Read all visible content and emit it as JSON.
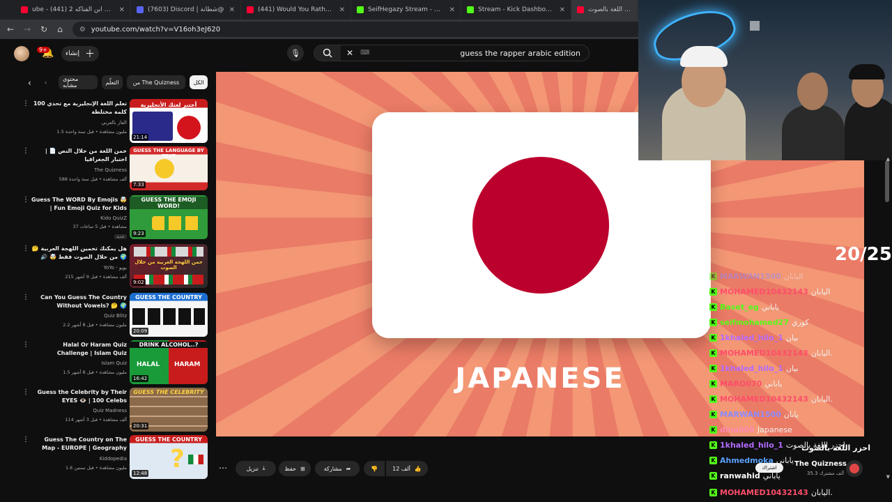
{
  "browser": {
    "tabs": [
      {
        "title": "(441) انا قلبي ابن الفناكه 2 - YouTube",
        "label": "ube - انا قلبي ابن الفناكه 2 (441)",
        "icon": "youtube-icon",
        "color": "#ff0033"
      },
      {
        "title": "(7603) Discord | شطانة@",
        "label": "(7603) Discord | شطانة@",
        "icon": "discord-icon",
        "color": "#5865f2"
      },
      {
        "title": "(441) Would You Rather...? 140",
        "label": "(441) Would You Rather...? 140",
        "icon": "youtube-icon",
        "color": "#ff0033"
      },
      {
        "title": "SeifHegazy Stream - Watch Live",
        "label": "SeifHegazy Stream - Watch Live",
        "icon": "kick-icon",
        "color": "#53fc18"
      },
      {
        "title": "Stream - Kick Dashboard",
        "label": "Stream - Kick Dashboard",
        "icon": "kick-icon",
        "color": "#53fc18"
      },
      {
        "title": "احزر اللغة بالصوت",
        "label": "احزر اللغة بالصوت",
        "icon": "youtube-icon",
        "color": "#ff0033"
      }
    ],
    "url": "youtube.com/watch?v=V16oh3eJ620"
  },
  "header": {
    "notif_count": "9+",
    "create_label": "إنشاء",
    "search_query": "guess the rapper arabic edition"
  },
  "chips": [
    "الكل",
    "من The Quizness",
    "التعلّم",
    "محتوى مشابه"
  ],
  "sidebar": {
    "videos": [
      {
        "title": "تعلم اللغة الإنجليزية مع تحدي 100 كلمة مختلطة",
        "channel": "الفاز بالعربي",
        "meta": "1.5 مليون مشاهدة • قبل سنة واحدة",
        "duration": "21:14",
        "thumb_text": "أختبر لغتك الأنجليزية",
        "thumb_color": "#c81c1c"
      },
      {
        "title": "خمن اللغة من خلال النص 📄 | اختبار الجغرافيا",
        "channel": "The Quizness",
        "meta": "588 ألف مشاهدة • قبل سنة واحدة",
        "duration": "7:33",
        "thumb_text": "GUESS THE LANGUAGE BY TEXT",
        "thumb_color": "#d22a2a"
      },
      {
        "title": "Guess The WORD By Emojis 🤯 | Fun Emoji Quiz for Kids",
        "channel": "Kido QuizZ",
        "meta": "37 مشاهدة • قبل 5 ساعات",
        "duration": "9:23",
        "thumb_text": "GUESS THE EMOJI WORD!",
        "thumb_color": "#2f9b3a",
        "tag": "جديد"
      },
      {
        "title": "هل يمكنك تخمين اللهجة العربية 🤔 🌍 من خلال الصوت فقط 🤯 🔊 تحدي اللهجات",
        "channel": "YoYo - يويو",
        "meta": "215 ألف مشاهدة • قبل 9 أشهر",
        "duration": "9:02",
        "thumb_text": "خمن اللهجة العربية من خلال الصوت",
        "thumb_color": "#7a1c2a"
      },
      {
        "title": "Can You Guess The Country Without Vowels? 🤔 🌍",
        "channel": "Quiz Blitz",
        "meta": "2.2 مليون مشاهدة • قبل 8 أشهر",
        "duration": "20:09",
        "thumb_text": "GUESS THE COUNTRY",
        "thumb_color": "#1c6fd1"
      },
      {
        "title": "Halal Or Haram Quiz Challenge | Islam Quiz",
        "channel": "Islam Quiz",
        "meta": "1.5 مليون مشاهدة • قبل 8 أشهر",
        "duration": "16:42",
        "thumb_text": "DRINK ALCOHOL..?",
        "thumb_color": "#b51c1c"
      },
      {
        "title": "Guess the Celebrity by Their EYES 👁️ | 100 Celebs",
        "channel": "Quiz Madness",
        "meta": "114 ألف مشاهدة • قبل 3 أشهر",
        "duration": "20:31",
        "thumb_text": "GUESS THE CELEBRITY",
        "thumb_color": "#6a4a2a"
      },
      {
        "title": "Guess The Country on The Map - EUROPE | Geography Quiz",
        "channel": "Kiddopedia",
        "meta": "1.6 مليون مشاهدة • قبل سنتين",
        "duration": "12:48",
        "thumb_text": "GUESS THE COUNTRY",
        "thumb_color": "#d8d8d8"
      }
    ]
  },
  "player": {
    "word": "JAPANESE",
    "counter": "20/25"
  },
  "actions": {
    "like_count": "12 ألف",
    "share": "مشاركة",
    "save": "حفظ",
    "download": "تنزيل"
  },
  "channel": {
    "name": "The Quizness",
    "subs": "35.3 ألف مشترك",
    "subscribe_label": "اشتراك"
  },
  "chat": [
    {
      "user": "MARWAN1500",
      "text": "اليابان",
      "color": "#8b8bff",
      "partial": true
    },
    {
      "user": "MOHAMED10432143",
      "text": "اليابان",
      "color": "#ff4d6a"
    },
    {
      "user": "Baset_eg",
      "text": "ياباني",
      "color": "#53fc18"
    },
    {
      "user": "seifmohamed27",
      "text": "كوري",
      "color": "#53fc18"
    },
    {
      "user": "1khaled_hilo_1",
      "text": "بيان",
      "color": "#b36bff"
    },
    {
      "user": "MOHAMED10432143",
      "text": "اليابان.",
      "color": "#ff4d6a"
    },
    {
      "user": "1khaled_hilo_1",
      "text": "بيان",
      "color": "#b36bff"
    },
    {
      "user": "MARO070",
      "text": "ياباني",
      "color": "#ff4d6a"
    },
    {
      "user": "MOHAMED10432143",
      "text": "اليابان.",
      "color": "#ff4d6a"
    },
    {
      "user": "MARWAN1500",
      "text": "يابان",
      "color": "#8b8bff"
    },
    {
      "user": "dina006",
      "text": "Japanese",
      "color": "#ff8ab0"
    },
    {
      "user": "1khaled_hilo_1",
      "text": "احزر اللغة بالصوت",
      "color": "#b36bff"
    },
    {
      "user": "Ahmedmoka",
      "text": "يابانى",
      "color": "#5aa0ff"
    },
    {
      "user": "ranwahid",
      "text": "ياباني",
      "color": "#ffffff"
    },
    {
      "user": "MOHAMED10432143",
      "text": "اليابان.",
      "color": "#ff4d6a"
    }
  ],
  "video_title_overlay": "احزر اللغة بالصوت"
}
